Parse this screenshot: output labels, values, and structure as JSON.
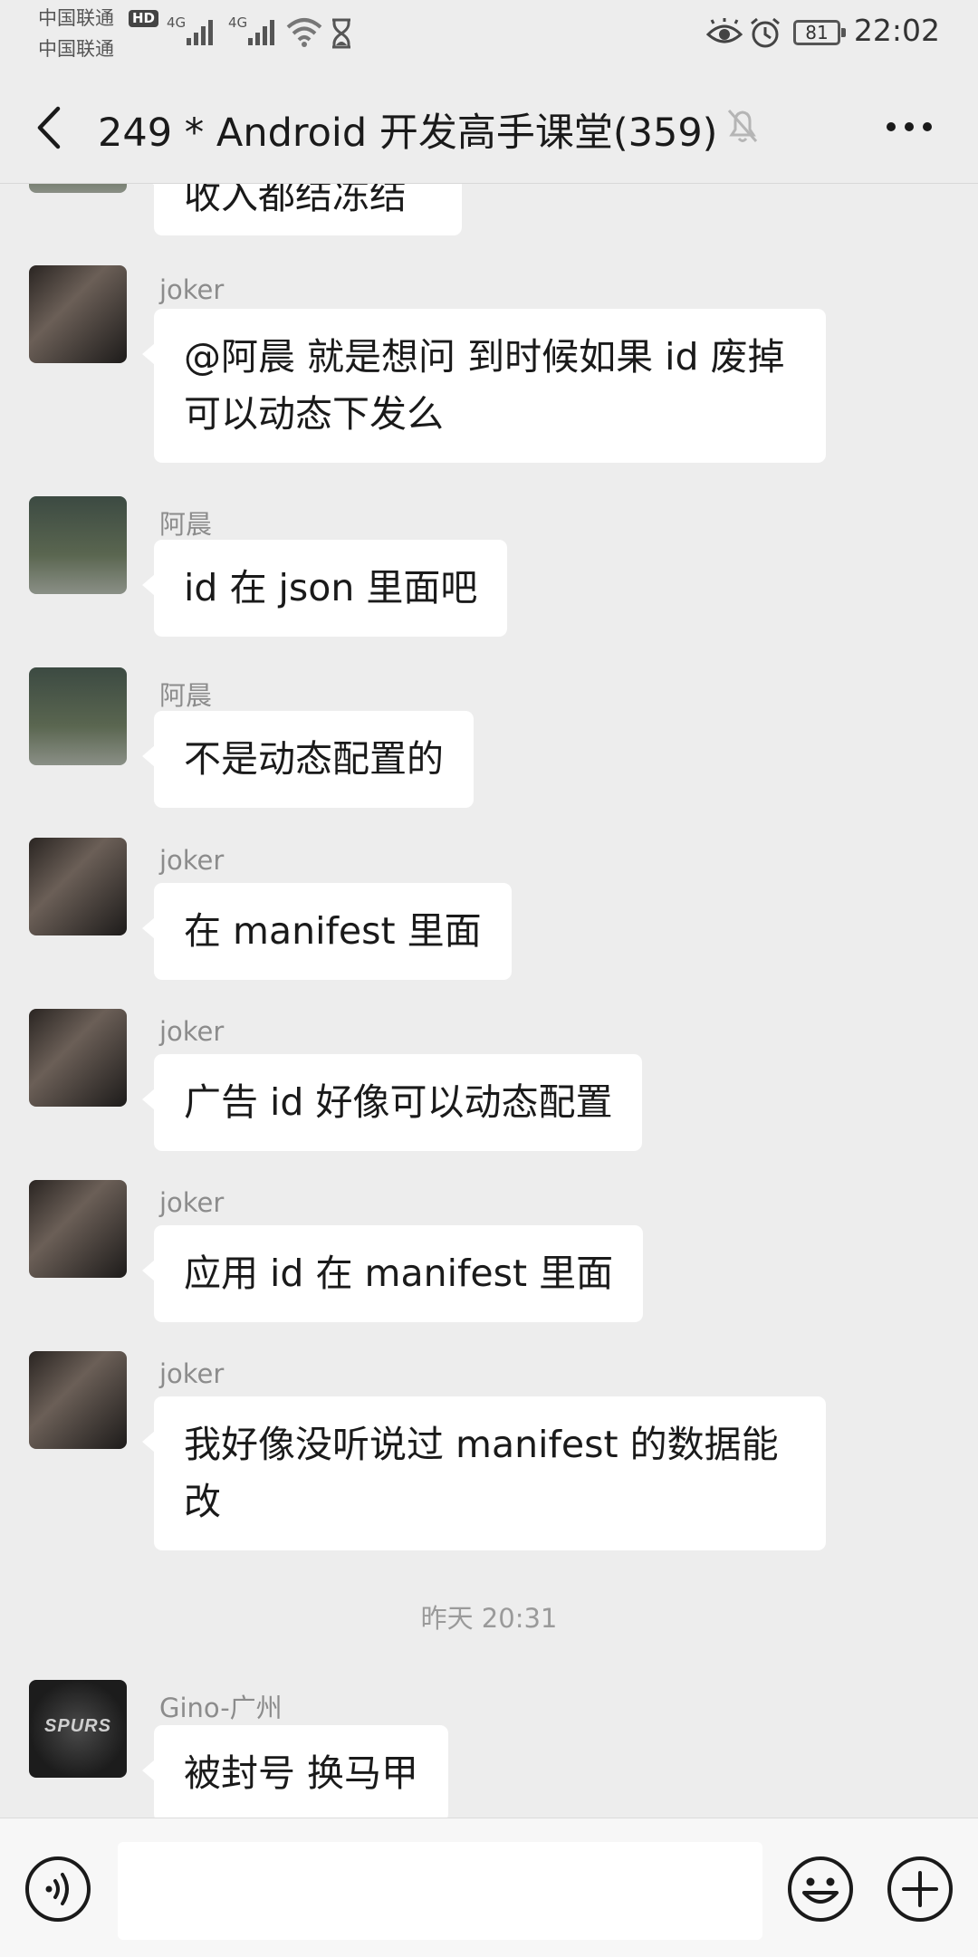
{
  "status_bar": {
    "carrier1": "中国联通",
    "carrier1_badge": "HD",
    "carrier2": "中国联通",
    "network1": "4G",
    "network2": "4G",
    "battery": "81",
    "time": "22:02"
  },
  "nav": {
    "title": "249 * Android 开发高手课堂(359)",
    "back_icon": "chevron-left-icon",
    "mute_icon": "bell-off-icon",
    "more_icon": "more-horizontal-icon"
  },
  "messages": [
    {
      "sender": "",
      "text": "收入都结冻结",
      "avatar": "partial"
    },
    {
      "sender": "joker",
      "text": "@阿晨  就是想问 到时候如果 id 废掉可以动态下发么",
      "avatar": "joker"
    },
    {
      "sender": "阿晨",
      "text": "id 在 json 里面吧",
      "avatar": "chen"
    },
    {
      "sender": "阿晨",
      "text": "不是动态配置的",
      "avatar": "chen"
    },
    {
      "sender": "joker",
      "text": "在 manifest 里面",
      "avatar": "joker"
    },
    {
      "sender": "joker",
      "text": "广告 id 好像可以动态配置",
      "avatar": "joker"
    },
    {
      "sender": "joker",
      "text": "应用 id 在 manifest 里面",
      "avatar": "joker"
    },
    {
      "sender": "joker",
      "text": "我好像没听说过 manifest 的数据能改",
      "avatar": "joker"
    }
  ],
  "timestamp": "昨天 20:31",
  "last_message": {
    "sender": "Gino-广州",
    "text": "被封号  换马甲",
    "avatar_text": "SPURS"
  },
  "input_bar": {
    "voice_icon": "voice-icon",
    "input_value": "",
    "emoji_icon": "emoji-icon",
    "plus_icon": "plus-circle-icon"
  }
}
